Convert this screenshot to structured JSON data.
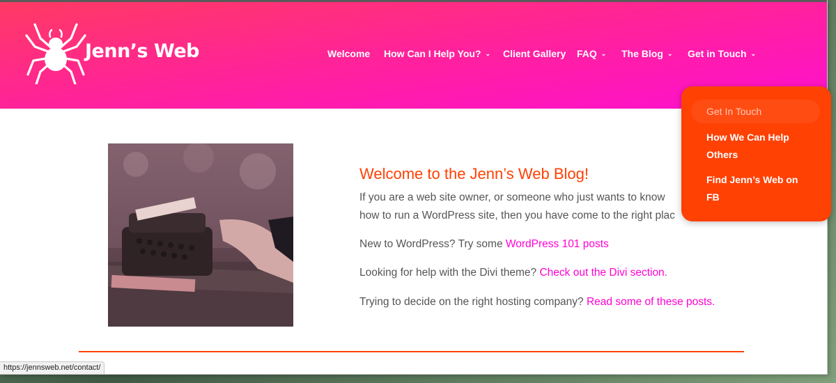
{
  "header": {
    "brand": "Jenn’s Web",
    "nav": [
      {
        "label": "Welcome",
        "has_dropdown": false
      },
      {
        "label": "How Can I Help You?",
        "has_dropdown": true
      },
      {
        "label": "Client Gallery",
        "has_dropdown": false
      },
      {
        "label": "FAQ",
        "has_dropdown": true
      },
      {
        "label": "The Blog",
        "has_dropdown": true
      },
      {
        "label": "Get in Touch",
        "has_dropdown": true
      }
    ],
    "chevron": "⌄"
  },
  "dropdown": {
    "items": [
      "Get In Touch",
      "How We Can Help Others",
      "Find Jenn’s Web on FB"
    ],
    "item_lines": [
      [
        "Get In Touch"
      ],
      [
        "How We Can Help",
        "Others"
      ],
      [
        "Find Jenn’s Web on",
        "FB"
      ]
    ]
  },
  "main": {
    "title": "Welcome to the Jenn’s Web Blog!",
    "intro_line1": "If you are a web site owner, or someone who just wants to know",
    "intro_line2": "how to run a WordPress site, then you have come to the right plac",
    "p1_text": "New to WordPress? Try some ",
    "p1_link": "WordPress 101 posts",
    "p2_text": "Looking for help with the Divi theme? ",
    "p2_link": "Check out the Divi section.",
    "p3_text": "Trying to decide on the right hosting company? ",
    "p3_link": "Read some of these posts."
  },
  "status_url": "https://jennsweb.net/contact/",
  "colors": {
    "accent": "#ff4104",
    "link": "#ff00d4",
    "header_start": "#ff3a63",
    "header_end": "#ff0fd0"
  },
  "icons": {
    "logo": "spider-icon",
    "nav_dropdown": "chevron-down-icon"
  }
}
